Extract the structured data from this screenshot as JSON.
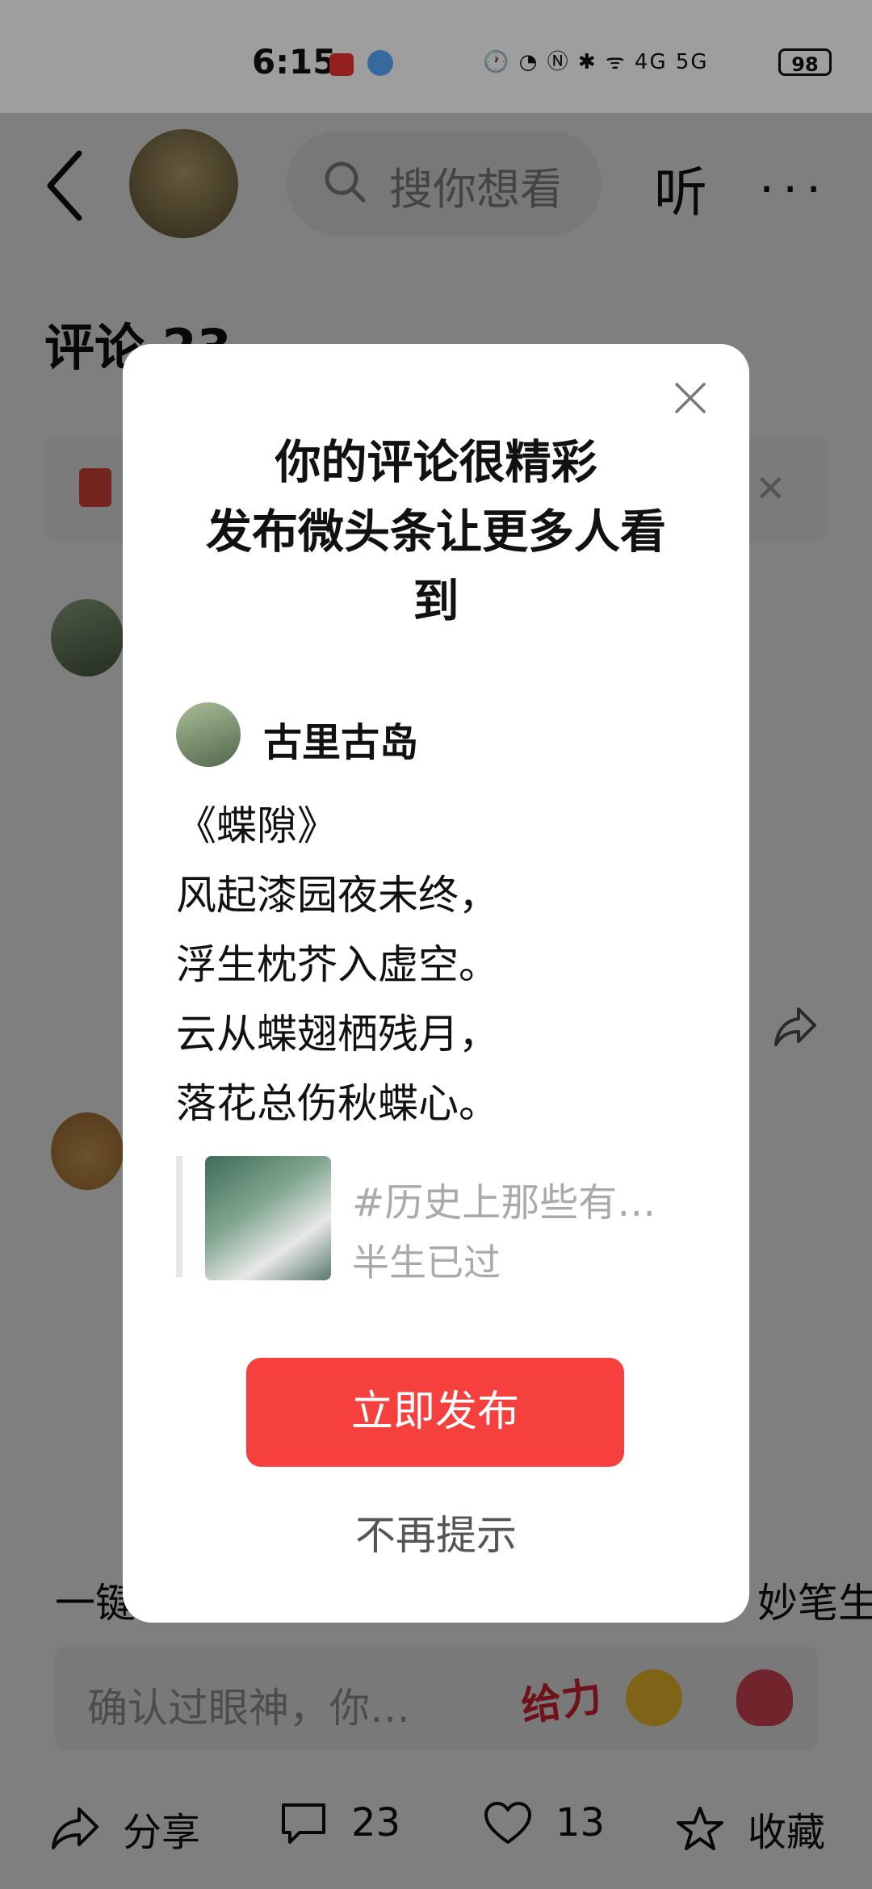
{
  "status": {
    "time": "6:15",
    "indicators": "🕐 ◔ Ⓝ ✱ ᯤ 4G 5G",
    "battery": "98"
  },
  "header": {
    "search_placeholder": "搜你想看",
    "listen_label": "听",
    "more_label": "···"
  },
  "background": {
    "comments_title": "评论 23",
    "left_partial": "一键",
    "right_partial": "妙笔生",
    "input_placeholder": "确认过眼神，你…",
    "emoji_label": "给力"
  },
  "bottom_bar": {
    "share_label": "分享",
    "comment_count": "23",
    "like_count": "13",
    "collect_label": "收藏"
  },
  "modal": {
    "title_line1": "你的评论很精彩",
    "title_line2": "发布微头条让更多人看",
    "title_line3": "到",
    "username": "古里古岛",
    "poem": [
      "《蝶隙》",
      "风起漆园夜未终，",
      "浮生枕芥入虚空。",
      "云从蝶翅栖残月，",
      "落花总伤秋蝶心。"
    ],
    "ref_title": "#历史上那些有…",
    "ref_subtitle": "半生已过",
    "publish_button": "立即发布",
    "no_remind": "不再提示"
  },
  "colors": {
    "accent": "#f5403d",
    "overlay": "rgba(0,0,0,0.5)"
  }
}
